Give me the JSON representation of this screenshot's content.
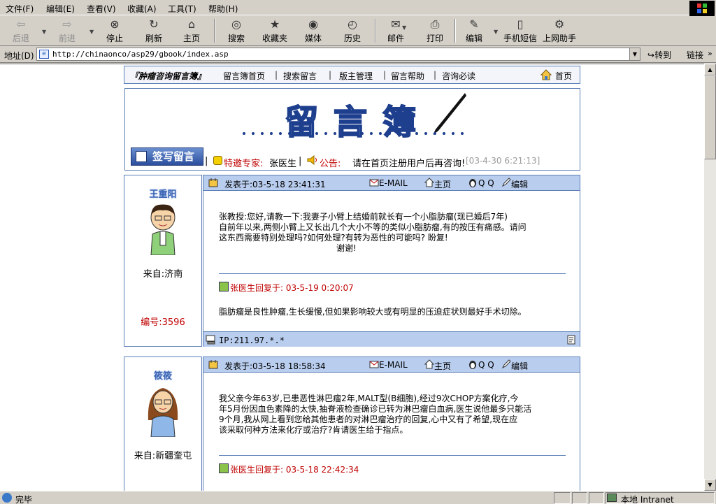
{
  "menu": [
    "文件(F)",
    "编辑(E)",
    "查看(V)",
    "收藏(A)",
    "工具(T)",
    "帮助(H)"
  ],
  "toolbar": {
    "back": "后退",
    "forward": "前进",
    "stop": "停止",
    "refresh": "刷新",
    "home": "主页",
    "search": "搜索",
    "favorites": "收藏夹",
    "media": "媒体",
    "history": "历史",
    "mail": "邮件",
    "print": "打印",
    "edit": "编辑",
    "sms": "手机短信",
    "assistant": "上网助手"
  },
  "address": {
    "label": "地址(D)",
    "url": "http://chinaonco/asp29/gbook/index.asp",
    "go": "转到",
    "links": "链接"
  },
  "status": {
    "text": "完毕",
    "zone": "本地 Intranet"
  },
  "nav": {
    "brand": "『肿瘤咨询留言簿』",
    "items": [
      "留言簿首页",
      "搜索留言",
      "版主管理",
      "留言帮助",
      "咨询必读"
    ],
    "home": "首页"
  },
  "banner": {
    "title": "留言簿",
    "write_button": "签写留言",
    "expert_label": "特邀专家:",
    "expert_name": "张医生",
    "notice_label": "公告:",
    "notice_text": "请在首页注册用户后再咨询!",
    "notice_date": "[03-4-30 6:21:13]"
  },
  "post_labels": {
    "posted_prefix": "发表于:",
    "email": "E-MAIL",
    "home": "主页",
    "qq": "Q Q",
    "edit": "编辑",
    "from_prefix": "来自:",
    "number_prefix": "编号:",
    "reply_suffix": "回复于:",
    "ip_prefix": "IP:"
  },
  "posts": [
    {
      "author": "王重阳",
      "from": "济南",
      "number": "3596",
      "posted": "03-5-18 23:41:31",
      "body": [
        "张教授:您好,请教一下:我妻子小臂上结婚前就长有一个小脂肪瘤(现已婚后7年)",
        "自前年以来,两侧小臂上又长出几个大小不等的类似小脂肪瘤,有的按压有痛感。请问",
        "这东西需要特别处理吗?如何处理?有转为恶性的可能吗? 盼复!",
        "谢谢!"
      ],
      "reply_by": "张医生",
      "reply_time": "03-5-19 0:20:07",
      "reply_text": "脂肪瘤是良性肿瘤,生长缓慢,但如果影响较大或有明显的压迫症状则最好手术切除。",
      "ip": "211.97.*.*"
    },
    {
      "author": "筱筱",
      "from": "新疆奎屯",
      "posted": "03-5-18 18:58:34",
      "body": [
        "我父亲今年63岁,已患恶性淋巴瘤2年,MALT型(B细胞),经过9次CHOP方案化疗,今",
        "年5月份因血色素降的太快,抽脊液检查确诊已转为淋巴瘤白血病,医生说他最多只能活",
        "9个月,我从网上看到您给其他患者的对淋巴瘤治疗的回复,心中又有了希望,现在应",
        "该采取何种方法来化疗或治疗?肯请医生给于指点。"
      ],
      "reply_by": "张医生",
      "reply_time": "03-5-18 22:42:34"
    }
  ],
  "colors": {
    "accent": "#5b7fb6",
    "header_bar": "#b9cdee",
    "red_text": "#c00000"
  }
}
